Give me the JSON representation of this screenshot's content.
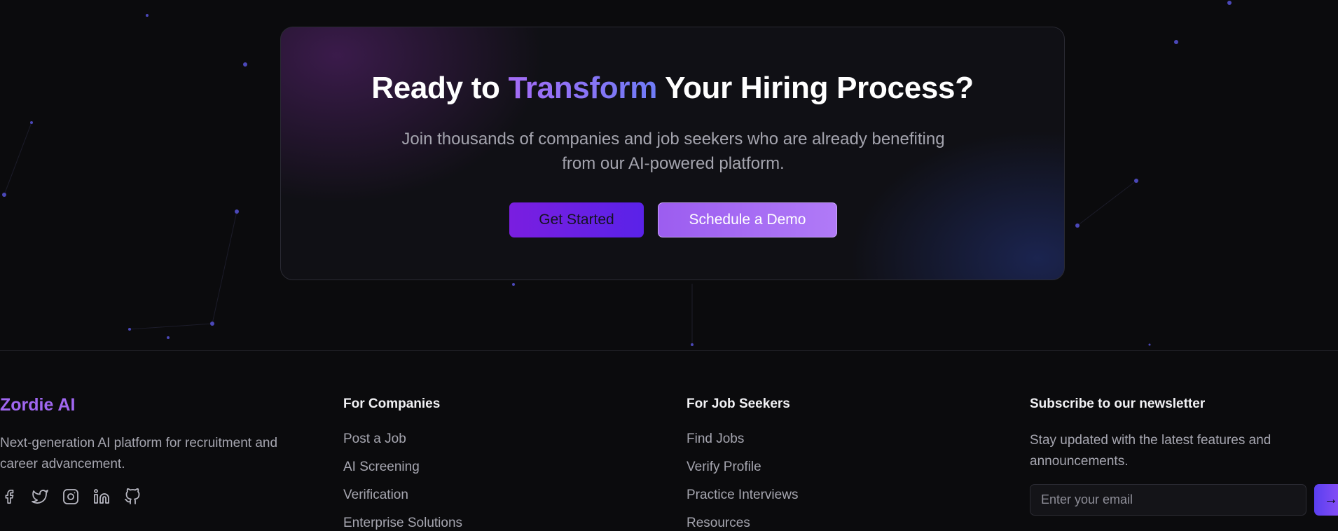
{
  "cta": {
    "title_part1": "Ready to ",
    "title_accent": "Transform",
    "title_part2": " Your Hiring Process?",
    "subtitle": "Join thousands of companies and job seekers who are already benefiting from our AI-powered platform.",
    "primary_button": "Get Started",
    "secondary_button": "Schedule a Demo"
  },
  "footer": {
    "brand": "Zordie AI",
    "description": "Next-generation AI platform for recruitment and career advancement.",
    "socials": [
      "facebook-icon",
      "twitter-icon",
      "instagram-icon",
      "linkedin-icon",
      "github-icon"
    ],
    "companies": {
      "title": "For Companies",
      "links": [
        "Post a Job",
        "AI Screening",
        "Verification",
        "Enterprise Solutions"
      ]
    },
    "seekers": {
      "title": "For Job Seekers",
      "links": [
        "Find Jobs",
        "Verify Profile",
        "Practice Interviews",
        "Resources"
      ]
    },
    "newsletter": {
      "title": "Subscribe to our newsletter",
      "description": "Stay updated with the latest features and announcements.",
      "placeholder": "Enter your email",
      "submit_icon": "arrow-right-icon"
    }
  },
  "colors": {
    "background": "#0b0b0d",
    "brand": "#a067f0",
    "accent_gradient_start": "#a56cf5",
    "accent_gradient_end": "#6f7cf7"
  }
}
